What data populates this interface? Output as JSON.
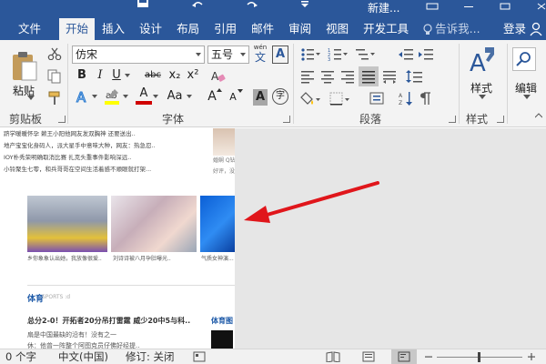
{
  "titlebar": {
    "doc_title": "新建...",
    "tabs": [
      "文件",
      "开始",
      "插入",
      "设计",
      "布局",
      "引用",
      "邮件",
      "审阅",
      "视图",
      "开发工具"
    ],
    "active_tab": "开始",
    "tell_me": "告诉我...",
    "login": "登录"
  },
  "ribbon": {
    "clipboard": {
      "paste": "粘贴",
      "label": "剪贴板"
    },
    "font": {
      "font_name": "仿宋",
      "font_size": "五号",
      "wen_glyph": "wén",
      "wen_char": "文",
      "A_char": "A",
      "bold": "B",
      "italic": "I",
      "underline": "U",
      "strike": "abc",
      "sub": "x₂",
      "sup": "x²",
      "font_color_char": "A",
      "aa": "Aa",
      "grow": "A",
      "shrink": "A",
      "char_shade": "A",
      "enclose": "字",
      "label": "字体"
    },
    "paragraph": {
      "label": "段落"
    },
    "styles": {
      "big": "样式",
      "label": "样式"
    },
    "editing": {
      "big": "编辑"
    }
  },
  "document": {
    "news_lines": [
      "跻学暖暖怀孕 赖王小阳他网友发双胸神 还要送出..",
      "地产宝宝化身码人，派大星手中意味大种，网友：热急忍..",
      "IOY朴秀荣明确取消比赛 扎克头重事件影响深远..",
      "小铃聚生七零，和兵哥哥在空间生活着感不顺眼就打架..."
    ],
    "side_captions": [
      "婚娴 Q钻",
      "好评，没"
    ],
    "photo_captions": [
      "乡你象象认出她，我放像很爱..",
      "刘诗诗被八月孕肚曝光..",
      "气质女神演..."
    ],
    "section_title": "体育",
    "section_sub": "SPORTS :d",
    "headline": "总分2-0！开拓者20分吊打雷霆 威少20中5与科..",
    "sport_tag": "体育图",
    "sub_lines": [
      "扇是中国最缺的沿有！没有之一",
      "休：他曾一阵整个阿图克员仔佛好经提.."
    ]
  },
  "status": {
    "word_count": "0 个字",
    "language": "中文(中国)",
    "track_changes": "修订: 关闭"
  },
  "colors": {
    "accent": "#2b579a",
    "ribbon_bg": "#f3f3f3",
    "arrow": "#e0161b",
    "font_color_bar": "#d00000",
    "highlight_bar": "#ffff00",
    "section_blue": "#1e5aa8"
  },
  "icons": {
    "save": "save-icon",
    "undo": "undo-icon",
    "redo": "redo-icon",
    "customize": "qat-dropdown-icon",
    "tell_me": "lightbulb-icon",
    "share": "share-icon",
    "paste": "clipboard-icon",
    "cut": "scissors-icon",
    "copy": "copy-icon",
    "format_painter": "format-painter-icon",
    "styles": "styles-brush-icon",
    "editing": "magnifier-icon",
    "annotation_arrow": "red-arrow-icon",
    "read_mode": "book-icon",
    "print_layout": "page-icon",
    "web_layout": "web-icon"
  }
}
